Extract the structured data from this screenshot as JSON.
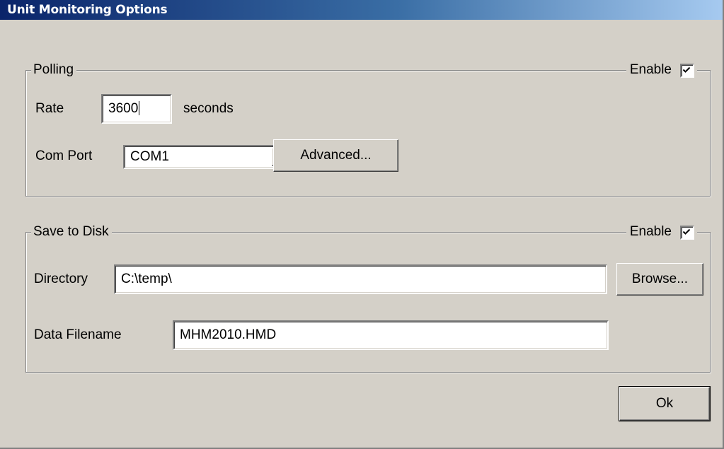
{
  "window": {
    "title": "Unit Monitoring Options"
  },
  "polling": {
    "legend": "Polling",
    "enable_label": "Enable",
    "enable_checked": true,
    "rate_label": "Rate",
    "rate_value": "3600",
    "rate_unit": "seconds",
    "com_port_label": "Com Port",
    "com_port_value": "COM1",
    "advanced_button": "Advanced..."
  },
  "save_to_disk": {
    "legend": "Save to Disk",
    "enable_label": "Enable",
    "enable_checked": true,
    "directory_label": "Directory",
    "directory_value": "C:\\temp\\",
    "browse_button": "Browse...",
    "filename_label": "Data Filename",
    "filename_value": "MHM2010.HMD"
  },
  "footer": {
    "ok_button": "Ok"
  },
  "icons": {
    "checkbox_check": "checkmark-icon",
    "dropdown": "triangle-down-icon"
  }
}
